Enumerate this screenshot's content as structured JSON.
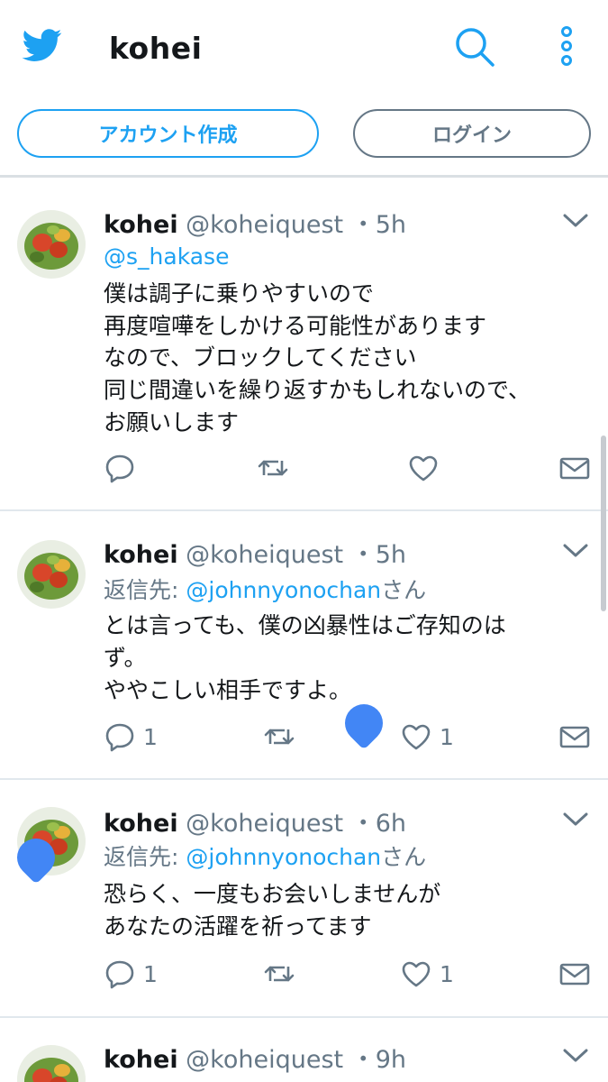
{
  "header": {
    "title": "kohei",
    "signup_label": "アカウント作成",
    "login_label": "ログイン",
    "icons": [
      "twitter-logo-icon",
      "search-icon",
      "more-vertical-icon"
    ],
    "accent_color": "#1da1f2"
  },
  "tweets": [
    {
      "name": "kohei",
      "handle": "@koheiquest",
      "time": "・5h",
      "mention": "@s_hakase",
      "lines": [
        "僕は調子に乗りやすいので",
        "再度喧嘩をしかける可能性があります",
        "なので、ブロックしてください",
        "同じ間違いを繰り返すかもしれないので、",
        "お願いします"
      ],
      "reply_count": "",
      "like_count": ""
    },
    {
      "name": "kohei",
      "handle": "@koheiquest",
      "time": "・5h",
      "reply_prefix": "返信先: ",
      "reply_user": "@johnnyonochan",
      "reply_suffix": "さん",
      "lines": [
        "とは言っても、僕の凶暴性はご存知のは",
        "ず。",
        "ややこしい相手ですよ。"
      ],
      "reply_count": "1",
      "like_count": "1"
    },
    {
      "name": "kohei",
      "handle": "@koheiquest",
      "time": "・6h",
      "reply_prefix": "返信先: ",
      "reply_user": "@johnnyonochan",
      "reply_suffix": "さん",
      "lines": [
        "恐らく、一度もお会いしませんが",
        "あなたの活躍を祈ってます"
      ],
      "reply_count": "1",
      "like_count": "1"
    },
    {
      "name": "kohei",
      "handle": "@koheiquest",
      "time": "・9h"
    }
  ]
}
